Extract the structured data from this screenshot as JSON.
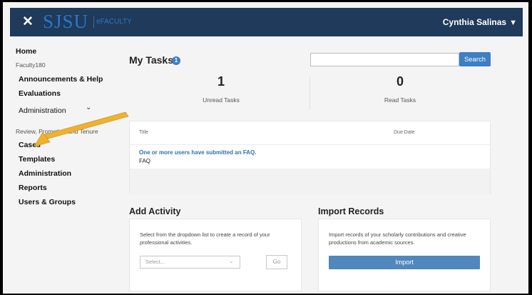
{
  "header": {
    "close_glyph": "✕",
    "logo_text": "SJSU",
    "logo_subtext": "eFACULTY",
    "user_name": "Cynthia Salinas",
    "user_chevron": "▼",
    "brand_color": "#1f3a5a"
  },
  "sidebar": {
    "home": "Home",
    "section1": "Faculty180",
    "items1": [
      "Announcements & Help",
      "Evaluations",
      "Administration"
    ],
    "admin_chevron": "⌄",
    "section2": "Review, Promotion and Tenure",
    "items2": [
      "Cases",
      "Templates",
      "Administration",
      "Reports",
      "Users & Groups"
    ]
  },
  "tasks": {
    "title": "My Tasks",
    "badge_count": "1",
    "search_placeholder": "",
    "search_button": "Search",
    "unread_count": "1",
    "unread_label": "Unread Tasks",
    "read_count": "0",
    "read_label": "Read Tasks",
    "col_title": "Title",
    "col_due": "Due Date",
    "rows": [
      {
        "title": "One or more users have submitted an FAQ.",
        "type": "FAQ",
        "due": ""
      }
    ]
  },
  "activity": {
    "title": "Add Activity",
    "description": "Select from the dropdown list to create a record of your professional activities.",
    "select_value": "Select...",
    "go_button": "Go"
  },
  "import": {
    "title": "Import Records",
    "description": "Import records of your scholarly contributions and creative productions from academic sources.",
    "button": "Import"
  },
  "annotation": {
    "arrow_color": "#f0b030"
  }
}
